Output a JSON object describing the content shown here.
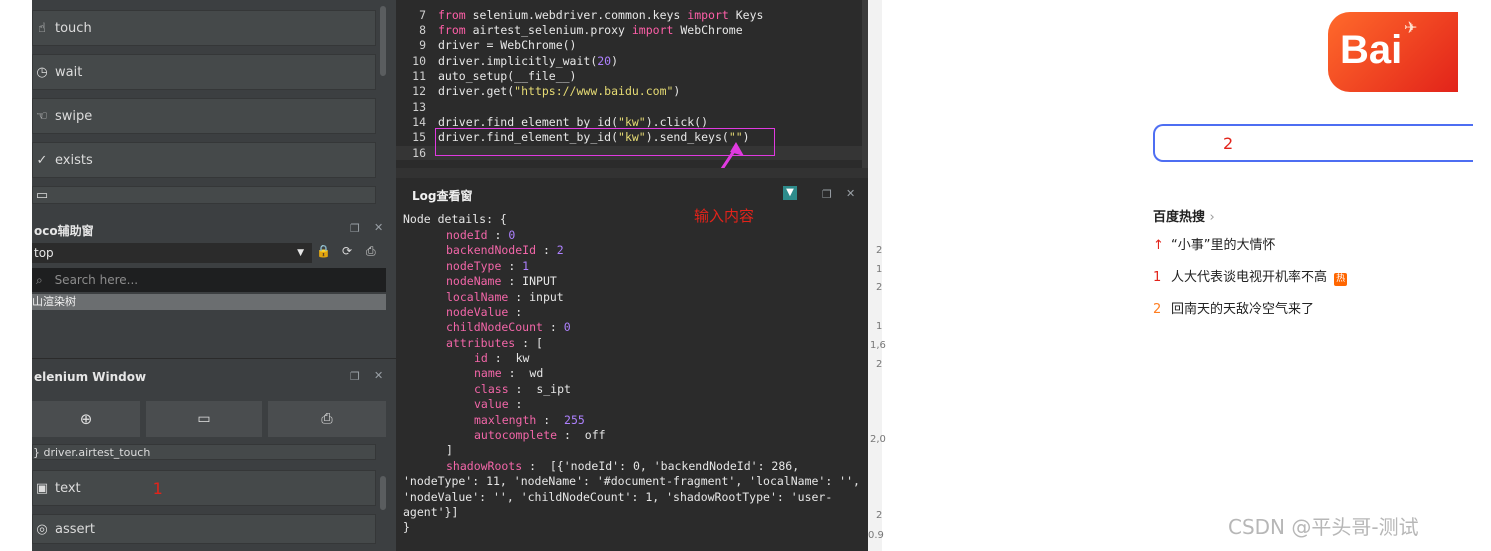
{
  "left_panel": {
    "tools": [
      {
        "icon": "touch-icon",
        "label": "touch"
      },
      {
        "icon": "clock-icon",
        "label": "wait"
      },
      {
        "icon": "swipe-icon",
        "label": "swipe"
      },
      {
        "icon": "check-icon",
        "label": "exists"
      }
    ],
    "poco": {
      "title": "oco辅助窗",
      "select_value": "top",
      "search_placeholder": "Search here...",
      "tree_item": "山渲染树"
    },
    "selenium": {
      "title": "elenium Window",
      "bottom_items": [
        {
          "icon": "",
          "label": "} driver.airtest_touch"
        },
        {
          "icon": "text-icon",
          "label": "text"
        },
        {
          "icon": "assert-icon",
          "label": "assert"
        }
      ],
      "annotation_1": "1"
    }
  },
  "editor": {
    "lines": [
      {
        "no": "7"
      },
      {
        "no": "8"
      },
      {
        "no": "9"
      },
      {
        "no": "10"
      },
      {
        "no": "11"
      },
      {
        "no": "12"
      },
      {
        "no": "13"
      },
      {
        "no": "14"
      },
      {
        "no": "15"
      },
      {
        "no": "16"
      }
    ],
    "code": {
      "l7a": "from",
      "l7b": " selenium.webdriver.common.keys ",
      "l7c": "import",
      "l7d": " Keys",
      "l8a": "from",
      "l8b": " airtest_selenium.proxy ",
      "l8c": "import",
      "l8d": " WebChrome",
      "l9": "driver = WebChrome()",
      "l10a": "driver.implicitly_wait(",
      "l10b": "20",
      "l10c": ")",
      "l11": "auto_setup(__file__)",
      "l12a": "driver.get(",
      "l12b": "\"https://www.baidu.com\"",
      "l12c": ")",
      "l14a": "driver.find_element_by_id(",
      "l14b": "\"kw\"",
      "l14c": ").click()",
      "l15a": "driver.find_element_by_id(",
      "l15b": "\"kw\"",
      "l15c": ").send_keys(",
      "l15d": "\"\"",
      "l15e": ")"
    },
    "annotation": "输入内容"
  },
  "log": {
    "title": "Log查看窗",
    "lines": {
      "header": "Node details: {",
      "k1": "nodeId",
      "v1": "0",
      "k2": "backendNodeId",
      "v2": "2",
      "k3": "nodeType",
      "v3": "1",
      "k4": "nodeName",
      "v4": "INPUT",
      "k5": "localName",
      "v5": "input",
      "k6": "nodeValue",
      "k7": "childNodeCount",
      "v7": "0",
      "k8": "attributes",
      "v8": "[",
      "a1k": "id",
      "a1v": "kw",
      "a2k": "name",
      "a2v": "wd",
      "a3k": "class",
      "a3v": "s_ipt",
      "a4k": "value",
      "a5k": "maxlength",
      "a5v": "255",
      "a6k": "autocomplete",
      "a6v": "off",
      "close_bracket": "]",
      "sr_key": "shadowRoots",
      "sr1": "[{'nodeId': 0, 'backendNodeId': 286,",
      "sr2": "'nodeType': 11, 'nodeName': '#document-fragment', 'localName': '',",
      "sr3": "'nodeValue': '', 'childNodeCount': 1, 'shadowRootType': 'user-",
      "sr4": "agent'}]",
      "close_brace": "}"
    },
    "side_numbers": [
      "2",
      "1",
      "2",
      "1",
      "1,6",
      "2",
      "2,0",
      "2",
      "0.9"
    ]
  },
  "baidu": {
    "logo_text": "Bai",
    "search_value": "2",
    "hot_title": "百度热搜",
    "hot_items": [
      {
        "rank": "↑",
        "text": "“小事”里的大情怀",
        "badge": ""
      },
      {
        "rank": "1",
        "text": "人大代表谈电视开机率不高",
        "badge": "热"
      },
      {
        "rank": "2",
        "text": "回南天的天敌冷空气来了",
        "badge": ""
      }
    ],
    "watermark": "CSDN @平头哥-测试"
  },
  "colors": {
    "accent": "#e2231a",
    "annotation": "#e03ae0",
    "search_border": "#4e6ef2"
  }
}
